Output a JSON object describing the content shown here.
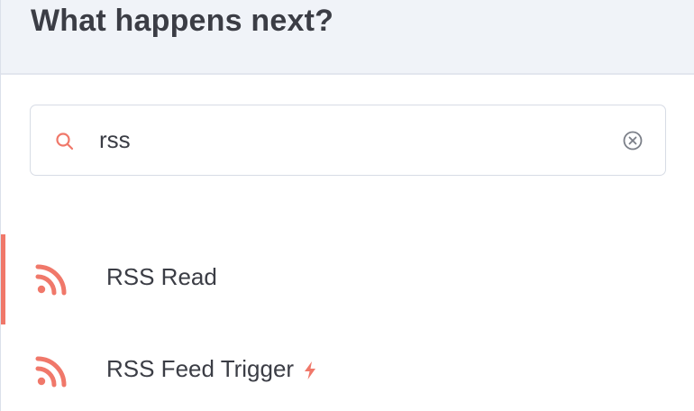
{
  "header": {
    "title": "What happens next?"
  },
  "search": {
    "value": "rss",
    "icon": "search-icon",
    "clear_icon": "close-circle-icon"
  },
  "results": [
    {
      "label": "RSS Read",
      "icon": "rss-icon",
      "active": true
    },
    {
      "label": "RSS Feed Trigger",
      "icon": "rss-icon",
      "badge_icon": "lightning-bolt-icon",
      "active": false
    }
  ],
  "colors": {
    "accent": "#f0786a",
    "text": "#3b3d45",
    "header_bg": "#f0f3f8",
    "border": "#d7dce5"
  }
}
